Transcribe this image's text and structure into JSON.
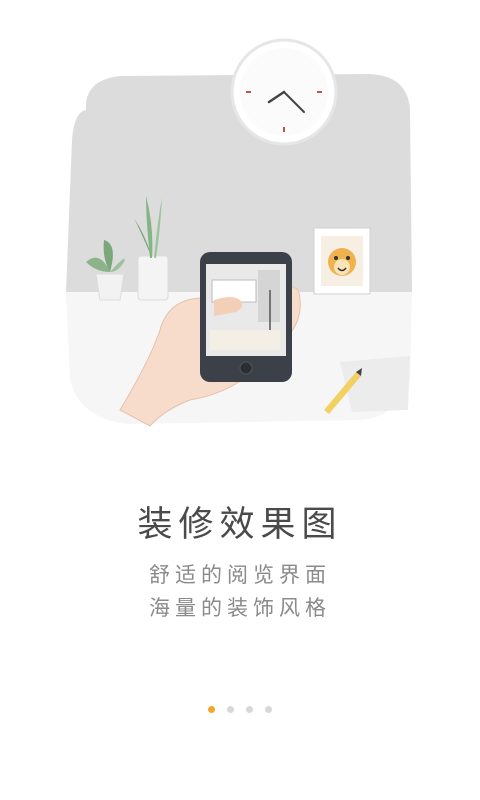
{
  "guide": {
    "title": "装修效果图",
    "subtitle_line1": "舒适的阅览界面",
    "subtitle_line2": "海量的装饰风格"
  },
  "pager": {
    "count": 4,
    "active_index": 0,
    "active_color": "#f2a62a",
    "inactive_color": "#d8d8d8"
  }
}
